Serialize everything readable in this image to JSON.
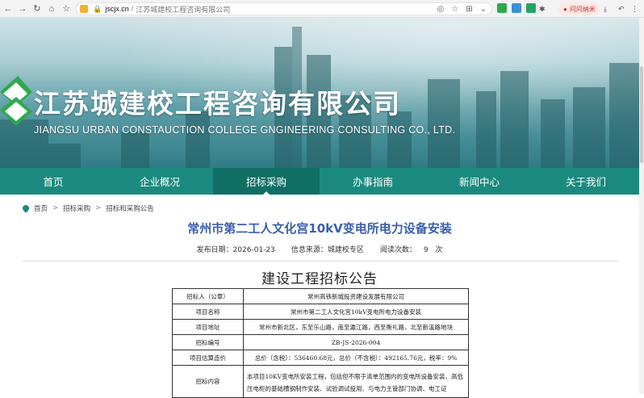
{
  "browser": {
    "domain": "jscjx.cn",
    "tab_title": "江苏城建校工程咨询有限公司",
    "favorites_label": "问问纳米"
  },
  "banner": {
    "brand_cn": "江苏城建校工程咨询有限公司",
    "brand_en": "JIANGSU URBAN CONSTAUCTION COLLEGE GNGINEERING CONSULTING CO., LTD."
  },
  "nav": {
    "items": [
      "首页",
      "企业概况",
      "招标采购",
      "办事指南",
      "新闻中心",
      "关于我们"
    ],
    "active": "招标采购"
  },
  "breadcrumb": [
    "首页",
    "招标采购",
    "招标和采购公告"
  ],
  "article": {
    "title": "常州市第二工人文化宫10kV变电所电力设备安装",
    "publish_label": "发布日期：",
    "publish_date": "2026-01-23",
    "source_label": "信息来源：",
    "source": "城建校专区",
    "views_label": "阅读次数：",
    "views": "9",
    "views_unit": "次",
    "doc_title": "建设工程招标公告"
  },
  "table": {
    "rows": [
      {
        "key": "招标人（公章）",
        "value": "常州高铁新城投资建设发展有限公司"
      },
      {
        "key": "项目名称",
        "value": "常州市第二工人文化宫10kV变电所电力设备安装"
      },
      {
        "key": "项目地址",
        "value": "常州市新北区，东至乐山路，南至瀛江路，西至衡礼路，北至新溪路地块"
      },
      {
        "key": "招标编号",
        "value": "ZB-JS-2026-004"
      },
      {
        "key": "项目估算造价",
        "value": "总价（含税）：536460.68元，总价（不含税）：492165.76元，税率：9%"
      },
      {
        "key": "招标内容",
        "value": "本项目10KV变电所安装工程，包括但不限于清单范围内的变电所设备安装、高低压电柜的基础槽钢制作安装、试验调试投用、与电力主管部门协调、电工证"
      }
    ]
  }
}
